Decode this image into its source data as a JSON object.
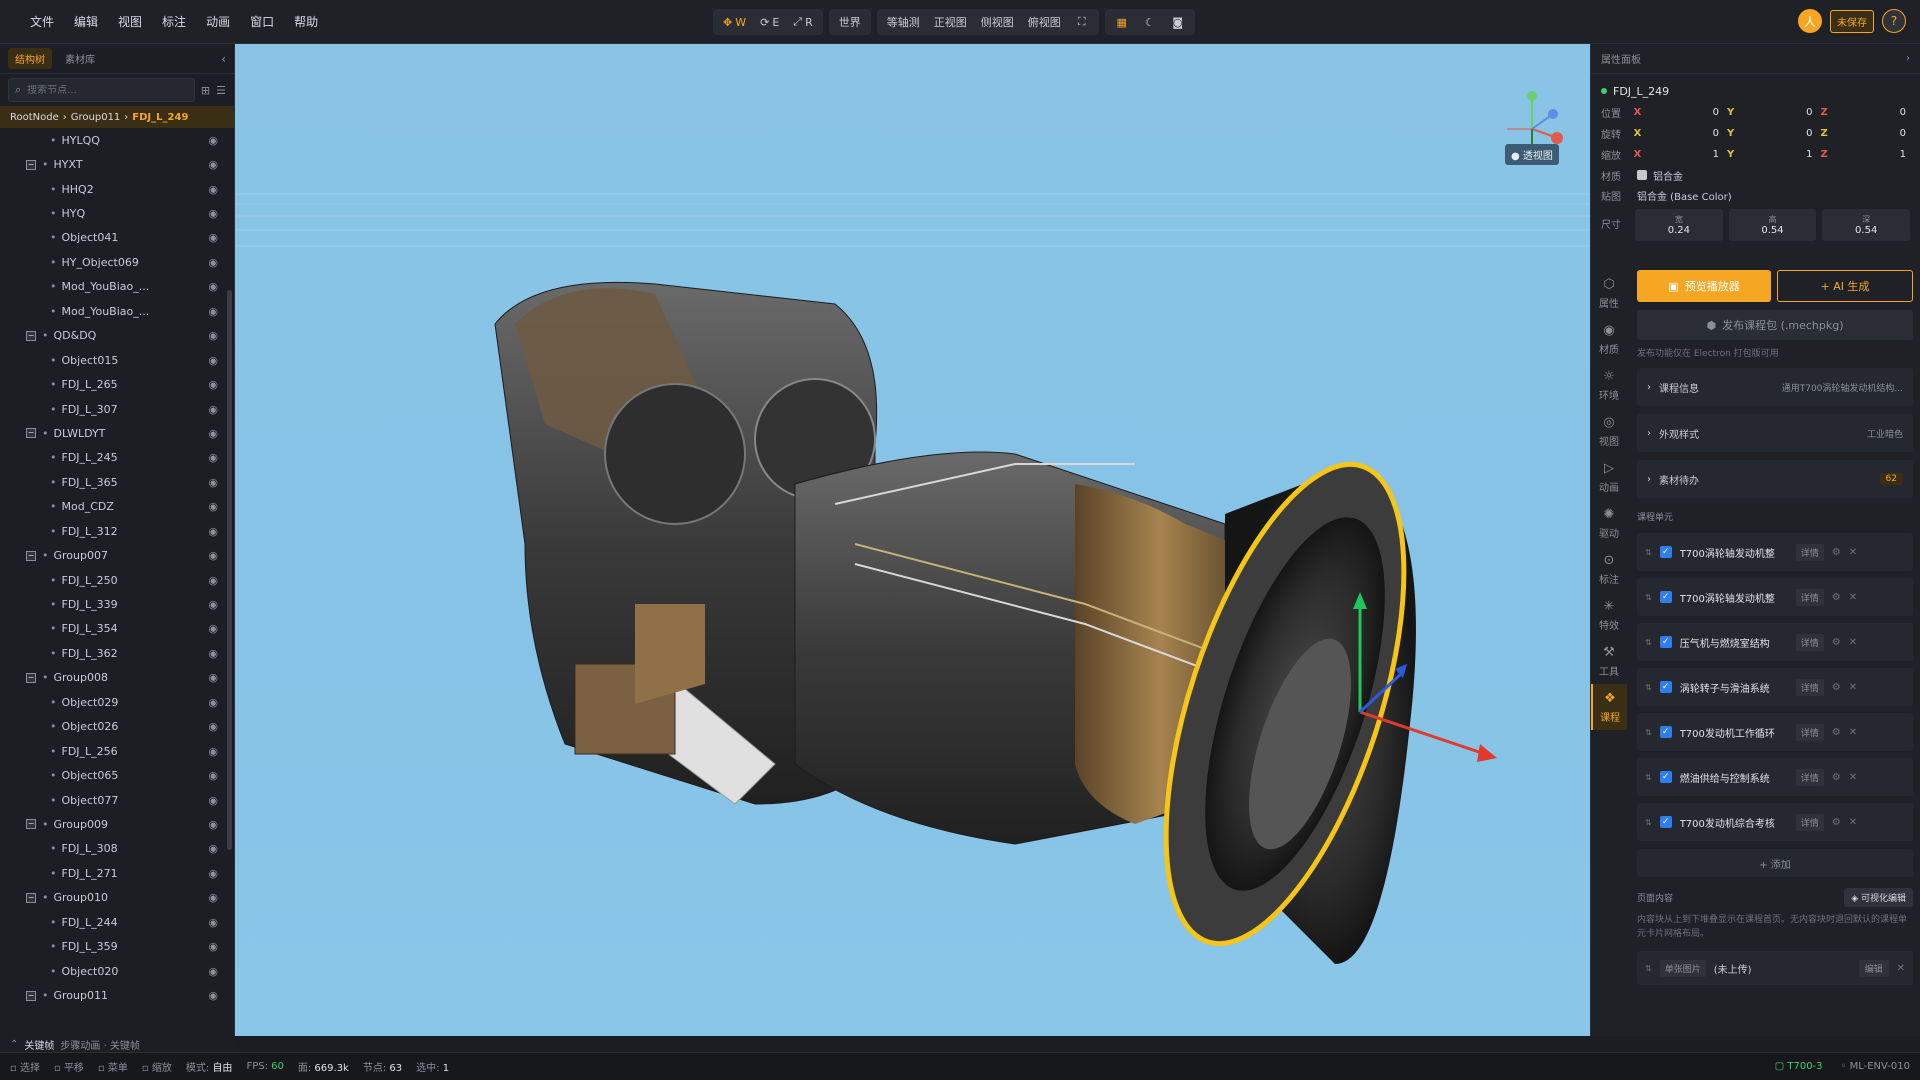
{
  "menu": [
    "文件",
    "编辑",
    "视图",
    "标注",
    "动画",
    "窗口",
    "帮助"
  ],
  "toolbar": {
    "transform": [
      {
        "icon": "move-icon",
        "key": "W"
      },
      {
        "icon": "rotate-icon",
        "key": "E"
      },
      {
        "icon": "scale-icon",
        "key": "R"
      }
    ],
    "space": "世界",
    "views": [
      "等轴测",
      "正视图",
      "侧视图",
      "俯视图"
    ],
    "unsaved": "未保存",
    "avatar": "人",
    "help": "?"
  },
  "left": {
    "tabs": [
      "结构树",
      "素材库"
    ],
    "search_placeholder": "搜索节点...",
    "breadcrumb": [
      "RootNode",
      "Group011",
      "FDJ_L_249"
    ],
    "tree": [
      {
        "label": "HYLQQ",
        "type": "child"
      },
      {
        "label": "HYXT",
        "type": "group"
      },
      {
        "label": "HHQ2",
        "type": "child"
      },
      {
        "label": "HYQ",
        "type": "child"
      },
      {
        "label": "Object041",
        "type": "child"
      },
      {
        "label": "HY_Object069",
        "type": "child"
      },
      {
        "label": "Mod_YouBiao_...",
        "type": "child"
      },
      {
        "label": "Mod_YouBiao_...",
        "type": "child"
      },
      {
        "label": "QD&DQ",
        "type": "group"
      },
      {
        "label": "Object015",
        "type": "child"
      },
      {
        "label": "FDJ_L_265",
        "type": "child"
      },
      {
        "label": "FDJ_L_307",
        "type": "child"
      },
      {
        "label": "DLWLDYT",
        "type": "group"
      },
      {
        "label": "FDJ_L_245",
        "type": "child"
      },
      {
        "label": "FDJ_L_365",
        "type": "child"
      },
      {
        "label": "Mod_CDZ",
        "type": "child"
      },
      {
        "label": "FDJ_L_312",
        "type": "child"
      },
      {
        "label": "Group007",
        "type": "group"
      },
      {
        "label": "FDJ_L_250",
        "type": "child"
      },
      {
        "label": "FDJ_L_339",
        "type": "child"
      },
      {
        "label": "FDJ_L_354",
        "type": "child"
      },
      {
        "label": "FDJ_L_362",
        "type": "child"
      },
      {
        "label": "Group008",
        "type": "group"
      },
      {
        "label": "Object029",
        "type": "child"
      },
      {
        "label": "Object026",
        "type": "child"
      },
      {
        "label": "FDJ_L_256",
        "type": "child"
      },
      {
        "label": "Object065",
        "type": "child"
      },
      {
        "label": "Object077",
        "type": "child"
      },
      {
        "label": "Group009",
        "type": "group"
      },
      {
        "label": "FDJ_L_308",
        "type": "child"
      },
      {
        "label": "FDJ_L_271",
        "type": "child"
      },
      {
        "label": "Group010",
        "type": "group"
      },
      {
        "label": "FDJ_L_244",
        "type": "child"
      },
      {
        "label": "FDJ_L_359",
        "type": "child"
      },
      {
        "label": "Object020",
        "type": "child"
      },
      {
        "label": "Group011",
        "type": "group"
      },
      {
        "label": "FDJ_L_249",
        "type": "child",
        "selected": true
      }
    ],
    "keyframe": "关键帧",
    "keyframe_hint": "步骤动画 · 关键帧"
  },
  "viewport": {
    "projection": "透视图"
  },
  "right": {
    "title": "属性面板",
    "object": "FDJ_L_249",
    "position": {
      "label": "位置",
      "x": "0",
      "y": "0",
      "z": "0"
    },
    "rotation": {
      "label": "旋转",
      "x": "0",
      "y": "0",
      "z": "0"
    },
    "scale": {
      "label": "缩放",
      "x": "1",
      "y": "1",
      "z": "1"
    },
    "material_label": "材质",
    "material": "铝合金",
    "texture_label": "贴图",
    "texture": "铝合金 (Base Color)",
    "size_label": "尺寸",
    "size": [
      {
        "l": "宽",
        "v": "0.24"
      },
      {
        "l": "高",
        "v": "0.54"
      },
      {
        "l": "深",
        "v": "0.54"
      }
    ],
    "nav": [
      {
        "icon": "hexagon-icon",
        "label": "属性"
      },
      {
        "icon": "material-icon",
        "label": "材质"
      },
      {
        "icon": "sun-icon",
        "label": "环境"
      },
      {
        "icon": "eye-icon",
        "label": "视图"
      },
      {
        "icon": "play-icon",
        "label": "动画"
      },
      {
        "icon": "drive-icon",
        "label": "驱动"
      },
      {
        "icon": "pin-icon",
        "label": "标注"
      },
      {
        "icon": "sparkle-icon",
        "label": "特效"
      },
      {
        "icon": "wrench-icon",
        "label": "工具"
      },
      {
        "icon": "course-icon",
        "label": "课程"
      }
    ],
    "preview_btn": "预览播放器",
    "ai_btn": "+ AI 生成",
    "publish_btn": "发布课程包 (.mechpkg)",
    "publish_note": "发布功能仅在 Electron 打包版可用",
    "sections": [
      {
        "label": "课程信息",
        "value": "通用T700涡轮轴发动机结构..."
      },
      {
        "label": "外观样式",
        "value": "工业暗色"
      },
      {
        "label": "素材待办",
        "badge": "62"
      }
    ],
    "units_label": "课程单元",
    "units": [
      "T700涡轮轴发动机整",
      "T700涡轮轴发动机整",
      "压气机与燃烧室结构",
      "涡轮转子与滑油系统",
      "T700发动机工作循环",
      "燃油供给与控制系统",
      "T700发动机综合考核"
    ],
    "detail": "详情",
    "add": "+ 添加",
    "page_label": "页面内容",
    "visual_edit": "可视化编辑",
    "page_note": "内容块从上到下堆叠显示在课程首页。无内容块时退回默认的课程单元卡片网格布局。",
    "image_tag": "单张图片",
    "image_state": "(未上传)",
    "edit": "编辑"
  },
  "status": {
    "controls": [
      "选择",
      "平移",
      "菜单",
      "缩放"
    ],
    "mode_label": "模式:",
    "mode": "自由",
    "fps_label": "FPS:",
    "fps": "60",
    "faces_label": "面:",
    "faces": "669.3k",
    "nodes_label": "节点:",
    "nodes": "63",
    "sel_label": "选中:",
    "sel": "1",
    "model": "T700-3",
    "env": "ML-ENV-010"
  }
}
